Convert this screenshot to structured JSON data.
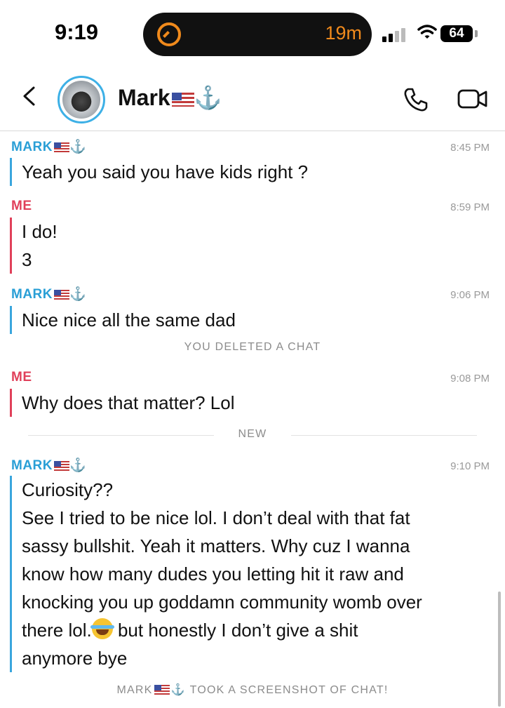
{
  "status_bar": {
    "time": "9:19",
    "activity_timer": "19m",
    "battery": "64"
  },
  "header": {
    "name": "Mark",
    "name_emoji": "🇺🇸⚓"
  },
  "messages": [
    {
      "sender": "MARK",
      "sender_emoji": "⚓",
      "time": "8:45 PM",
      "lines": [
        "Yeah you said you have kids right ?"
      ]
    },
    {
      "sender": "ME",
      "time": "8:59 PM",
      "lines": [
        "I do!",
        "3"
      ]
    },
    {
      "sender": "MARK",
      "sender_emoji": "⚓",
      "time": "9:06 PM",
      "lines": [
        "Nice nice all the same dad"
      ]
    },
    {
      "sender": "ME",
      "time": "9:08 PM",
      "lines": [
        "Why does that matter? Lol"
      ]
    },
    {
      "sender": "MARK",
      "sender_emoji": "⚓",
      "time": "9:10 PM",
      "lines": [
        "Curiosity??",
        "See I tried to be nice lol. I don’t deal with that fat",
        "sassy bullshit. Yeah it matters. Why cuz I wanna",
        "know how many dudes you letting hit it raw and",
        "knocking you up goddamn community womb over",
        "there lol.",
        "but honestly I don’t give a shit",
        "anymore bye"
      ]
    }
  ],
  "system": {
    "deleted": "YOU DELETED A CHAT",
    "new_label": "NEW",
    "screenshot_prefix": "MARK",
    "screenshot_text": "TOOK A SCREENSHOT OF CHAT!"
  },
  "icons": {
    "back": "chevron-left-icon",
    "call": "phone-icon",
    "video": "video-camera-icon",
    "laugh": "tears-of-joy-emoji"
  },
  "colors": {
    "mark_accent": "#2a9fd6",
    "me_accent": "#e0405a",
    "activity_accent": "#f08a1c"
  }
}
